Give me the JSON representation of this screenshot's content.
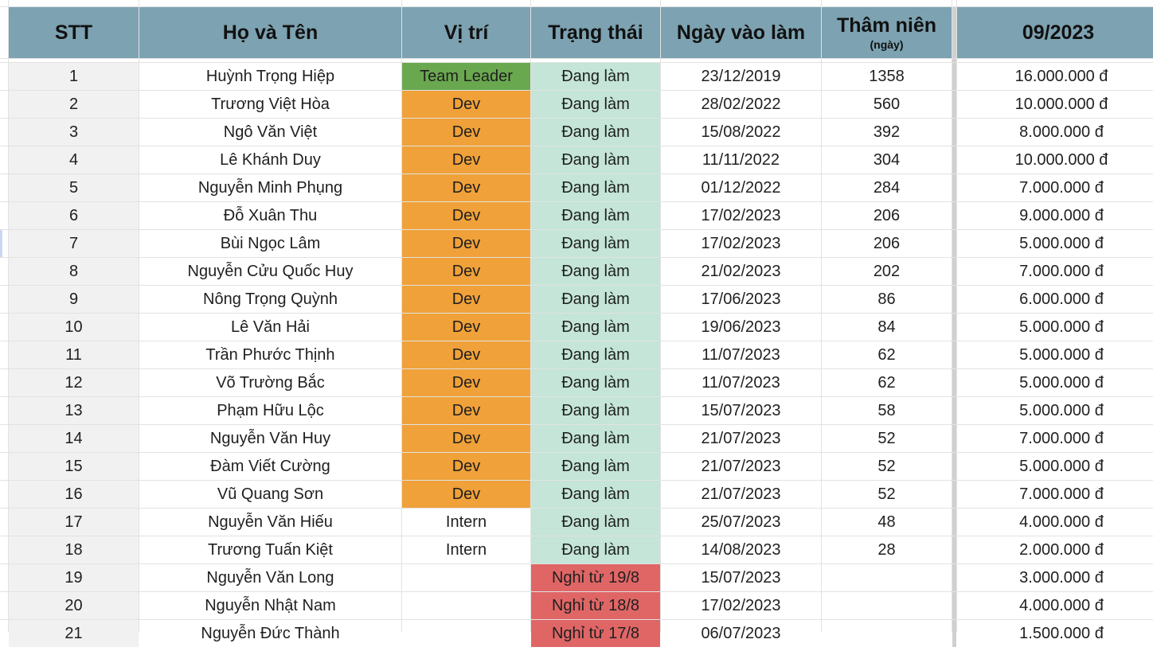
{
  "sheet": {
    "headers": {
      "stt": "STT",
      "name": "Họ và Tên",
      "position": "Vị trí",
      "status": "Trạng thái",
      "start_date": "Ngày vào làm",
      "seniority": "Thâm niên",
      "seniority_unit": "(ngày)",
      "month": "09/2023"
    },
    "rows": [
      {
        "stt": "1",
        "name": "Huỳnh Trọng Hiệp",
        "position": "Team Leader",
        "pos_type": "leader",
        "status": "Đang làm",
        "status_type": "active",
        "start": "23/12/2019",
        "days": "1358",
        "salary": "16.000.000 đ"
      },
      {
        "stt": "2",
        "name": "Trương Việt Hòa",
        "position": "Dev",
        "pos_type": "dev",
        "status": "Đang làm",
        "status_type": "active",
        "start": "28/02/2022",
        "days": "560",
        "salary": "10.000.000 đ"
      },
      {
        "stt": "3",
        "name": "Ngô Văn Việt",
        "position": "Dev",
        "pos_type": "dev",
        "status": "Đang làm",
        "status_type": "active",
        "start": "15/08/2022",
        "days": "392",
        "salary": "8.000.000 đ"
      },
      {
        "stt": "4",
        "name": "Lê Khánh Duy",
        "position": "Dev",
        "pos_type": "dev",
        "status": "Đang làm",
        "status_type": "active",
        "start": "11/11/2022",
        "days": "304",
        "salary": "10.000.000 đ"
      },
      {
        "stt": "5",
        "name": "Nguyễn Minh Phụng",
        "position": "Dev",
        "pos_type": "dev",
        "status": "Đang làm",
        "status_type": "active",
        "start": "01/12/2022",
        "days": "284",
        "salary": "7.000.000 đ"
      },
      {
        "stt": "6",
        "name": "Đỗ Xuân Thu",
        "position": "Dev",
        "pos_type": "dev",
        "status": "Đang làm",
        "status_type": "active",
        "start": "17/02/2023",
        "days": "206",
        "salary": "9.000.000 đ"
      },
      {
        "stt": "7",
        "name": "Bùi Ngọc Lâm",
        "position": "Dev",
        "pos_type": "dev",
        "status": "Đang làm",
        "status_type": "active",
        "start": "17/02/2023",
        "days": "206",
        "salary": "5.000.000 đ"
      },
      {
        "stt": "8",
        "name": "Nguyễn Cửu Quốc Huy",
        "position": "Dev",
        "pos_type": "dev",
        "status": "Đang làm",
        "status_type": "active",
        "start": "21/02/2023",
        "days": "202",
        "salary": "7.000.000 đ"
      },
      {
        "stt": "9",
        "name": "Nông Trọng Quỳnh",
        "position": "Dev",
        "pos_type": "dev",
        "status": "Đang làm",
        "status_type": "active",
        "start": "17/06/2023",
        "days": "86",
        "salary": "6.000.000 đ"
      },
      {
        "stt": "10",
        "name": "Lê Văn Hải",
        "position": "Dev",
        "pos_type": "dev",
        "status": "Đang làm",
        "status_type": "active",
        "start": "19/06/2023",
        "days": "84",
        "salary": "5.000.000 đ"
      },
      {
        "stt": "11",
        "name": "Trần Phước Thịnh",
        "position": "Dev",
        "pos_type": "dev",
        "status": "Đang làm",
        "status_type": "active",
        "start": "11/07/2023",
        "days": "62",
        "salary": "5.000.000 đ"
      },
      {
        "stt": "12",
        "name": "Võ Trường Bắc",
        "position": "Dev",
        "pos_type": "dev",
        "status": "Đang làm",
        "status_type": "active",
        "start": "11/07/2023",
        "days": "62",
        "salary": "5.000.000 đ"
      },
      {
        "stt": "13",
        "name": "Phạm Hữu Lộc",
        "position": "Dev",
        "pos_type": "dev",
        "status": "Đang làm",
        "status_type": "active",
        "start": "15/07/2023",
        "days": "58",
        "salary": "5.000.000 đ"
      },
      {
        "stt": "14",
        "name": "Nguyễn Văn Huy",
        "position": "Dev",
        "pos_type": "dev",
        "status": "Đang làm",
        "status_type": "active",
        "start": "21/07/2023",
        "days": "52",
        "salary": "7.000.000 đ"
      },
      {
        "stt": "15",
        "name": "Đàm Viết Cường",
        "position": "Dev",
        "pos_type": "dev",
        "status": "Đang làm",
        "status_type": "active",
        "start": "21/07/2023",
        "days": "52",
        "salary": "5.000.000 đ"
      },
      {
        "stt": "16",
        "name": "Vũ Quang Sơn",
        "position": "Dev",
        "pos_type": "dev",
        "status": "Đang làm",
        "status_type": "active",
        "start": "21/07/2023",
        "days": "52",
        "salary": "7.000.000 đ"
      },
      {
        "stt": "17",
        "name": "Nguyễn Văn Hiếu",
        "position": "Intern",
        "pos_type": "intern",
        "status": "Đang làm",
        "status_type": "active",
        "start": "25/07/2023",
        "days": "48",
        "salary": "4.000.000 đ"
      },
      {
        "stt": "18",
        "name": "Trương Tuấn Kiệt",
        "position": "Intern",
        "pos_type": "intern",
        "status": "Đang làm",
        "status_type": "active",
        "start": "14/08/2023",
        "days": "28",
        "salary": "2.000.000 đ"
      },
      {
        "stt": "19",
        "name": "Nguyễn Văn Long",
        "position": "",
        "pos_type": "none",
        "status": "Nghỉ từ 19/8",
        "status_type": "left",
        "start": "15/07/2023",
        "days": "",
        "salary": "3.000.000 đ"
      },
      {
        "stt": "20",
        "name": "Nguyễn Nhật Nam",
        "position": "",
        "pos_type": "none",
        "status": "Nghỉ từ 18/8",
        "status_type": "left",
        "start": "17/02/2023",
        "days": "",
        "salary": "4.000.000 đ"
      },
      {
        "stt": "21",
        "name": "Nguyễn Đức Thành",
        "position": "",
        "pos_type": "none",
        "status": "Nghỉ từ 17/8",
        "status_type": "left",
        "start": "06/07/2023",
        "days": "",
        "salary": "1.500.000 đ"
      }
    ]
  },
  "colors": {
    "header_bg": "#7da2b1",
    "team_leader": "#6aa84f",
    "dev": "#f0a139",
    "active": "#c4e5d7",
    "left": "#e06666"
  }
}
